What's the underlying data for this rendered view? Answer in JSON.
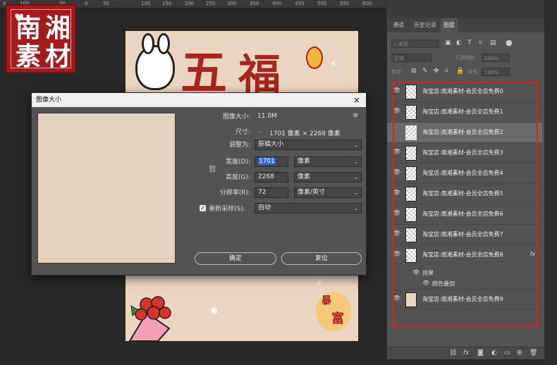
{
  "ruler": {
    "ticks": [
      "0",
      "100",
      "50",
      "0",
      "50",
      "100",
      "150",
      "200",
      "250",
      "300",
      "350",
      "400",
      "450",
      "500",
      "550",
      "600"
    ]
  },
  "logo": {
    "chars": [
      "南",
      "湘",
      "素",
      "材"
    ]
  },
  "canvas": {
    "title_chars": [
      "五",
      "福"
    ],
    "stamp_chars": [
      "暴",
      "富"
    ]
  },
  "dialog": {
    "title": "图像大小",
    "close_glyph": "×",
    "image_size_label": "图像大小:",
    "image_size_value": "11.0M",
    "dimension_label": "尺寸:",
    "dimension_value": "1701 像素  ×  2268 像素",
    "fit_label": "调整为:",
    "fit_value": "原稿大小",
    "width_label": "宽度(D):",
    "width_value": "1701",
    "width_unit": "像素",
    "height_label": "高度(G):",
    "height_value": "2268",
    "height_unit": "像素",
    "resolution_label": "分辨率(R):",
    "resolution_value": "72",
    "resolution_unit": "像素/英寸",
    "resample_label": "重新采样(S):",
    "resample_value": "自动",
    "ok_label": "确定",
    "reset_label": "复位"
  },
  "panel": {
    "tabs": [
      "通道",
      "历史记录",
      "图层"
    ],
    "active_tab": "图层",
    "filter_placeholder": "类型",
    "blend_mode": "正常",
    "opacity_label": "不透明度:",
    "opacity_value": "100%",
    "lock_label": "锁定:",
    "fill_label": "填充:",
    "fill_value": "100%",
    "layers": [
      {
        "name": "淘宝店:南湘素材-会员全店免费0"
      },
      {
        "name": "淘宝店:南湘素材-会员全店免费1"
      },
      {
        "name": "淘宝店:南湘素材-会员全店免费2"
      },
      {
        "name": "淘宝店:南湘素材-会员全店免费3"
      },
      {
        "name": "淘宝店:南湘素材-会员全店免费4"
      },
      {
        "name": "淘宝店:南湘素材-会员全店免费5"
      },
      {
        "name": "淘宝店:南湘素材-会员全店免费6"
      },
      {
        "name": "淘宝店:南湘素材-会员全店免费7"
      },
      {
        "name": "淘宝店:南湘素材-会员全店免费8"
      },
      {
        "name": "淘宝店:南湘素材-会员全店免费9"
      }
    ],
    "fx_label": "fx",
    "effects_label": "效果",
    "color_overlay_label": "颜色叠加"
  },
  "colors": {
    "highlight_box": "#e02020",
    "selection": "#2d6bd6"
  }
}
